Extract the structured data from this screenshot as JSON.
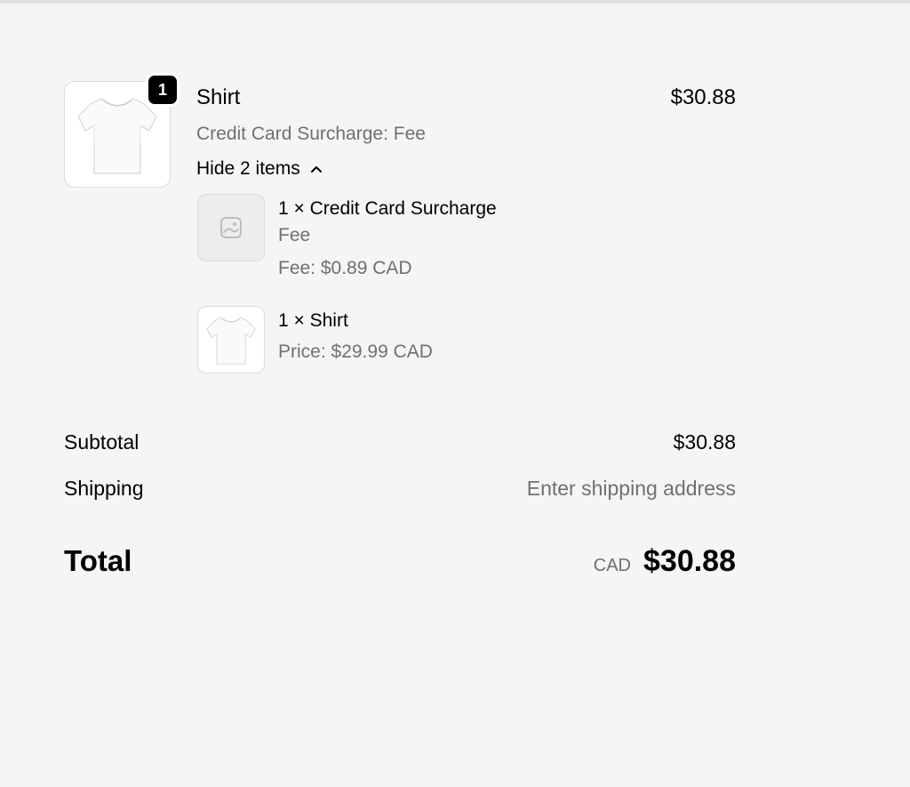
{
  "product": {
    "quantity_badge": "1",
    "title": "Shirt",
    "price": "$30.88",
    "variant": "Credit Card Surcharge: Fee",
    "toggle_label": "Hide 2 items",
    "image_icon": "tshirt-image",
    "chevron_icon": "chevron-up-icon"
  },
  "bundle_items": [
    {
      "name": "1 × Credit Card Surcharge",
      "detail": "Fee",
      "price_line": "Fee: $0.89 CAD",
      "image_icon": "image-placeholder-icon"
    },
    {
      "name": "1 × Shirt",
      "price_line": "Price: $29.99 CAD",
      "image_icon": "tshirt-image"
    }
  ],
  "totals": {
    "subtotal_label": "Subtotal",
    "subtotal_value": "$30.88",
    "shipping_label": "Shipping",
    "shipping_value": "Enter shipping address",
    "total_label": "Total",
    "total_currency": "CAD",
    "total_value": "$30.88"
  },
  "colors": {
    "background": "#f5f5f5",
    "muted_text": "#707070",
    "badge": "#000000"
  }
}
